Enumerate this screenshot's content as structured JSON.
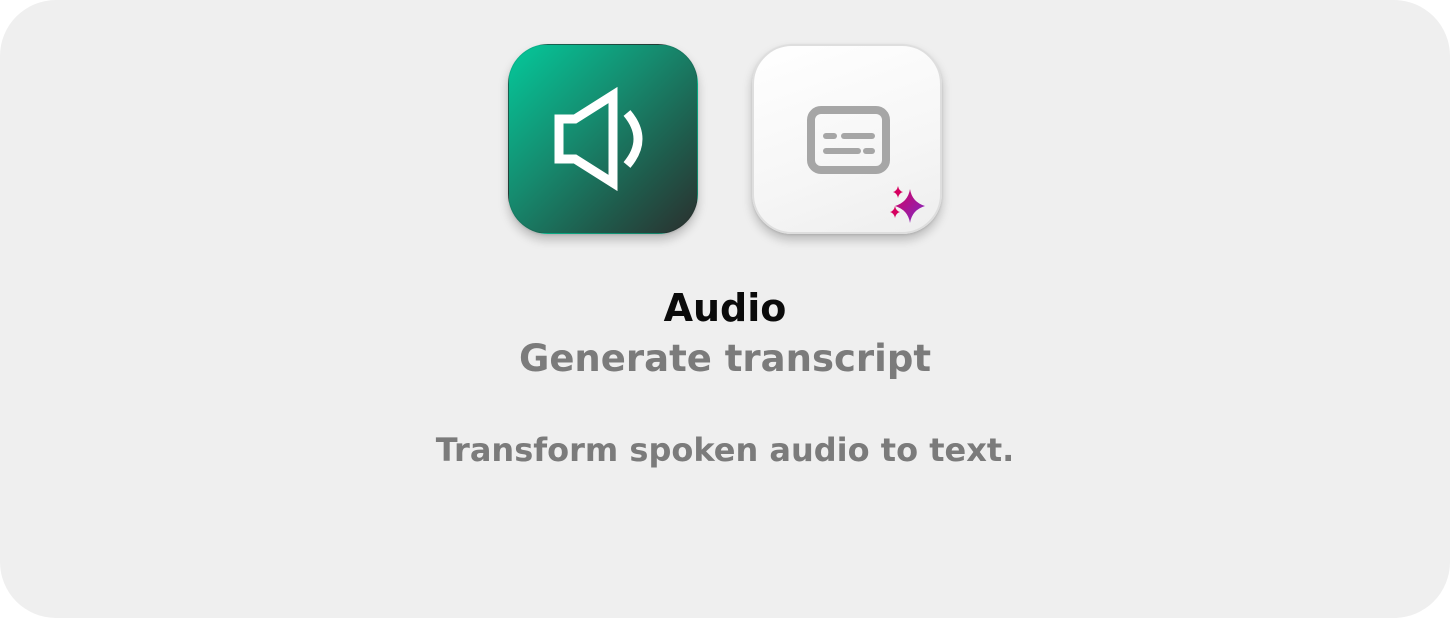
{
  "card": {
    "background": "#efefef"
  },
  "icons": {
    "audio": {
      "name": "speaker-volume-icon",
      "tile_gradient": [
        "#04c99b",
        "#2b2f2e"
      ],
      "glyph_color": "#ffffff"
    },
    "transcript": {
      "name": "closed-caption-icon",
      "tile_background": "#ffffff",
      "glyph_color": "#a6a6a6",
      "badge": {
        "name": "sparkle-icon",
        "colors": [
          "#d6005f",
          "#7b2cc9"
        ]
      }
    }
  },
  "text": {
    "title": "Audio",
    "subtitle": "Generate transcript",
    "description": "Transform spoken audio to text."
  },
  "colors": {
    "title": "#0b0b0b",
    "secondary": "#7b7b7b"
  }
}
